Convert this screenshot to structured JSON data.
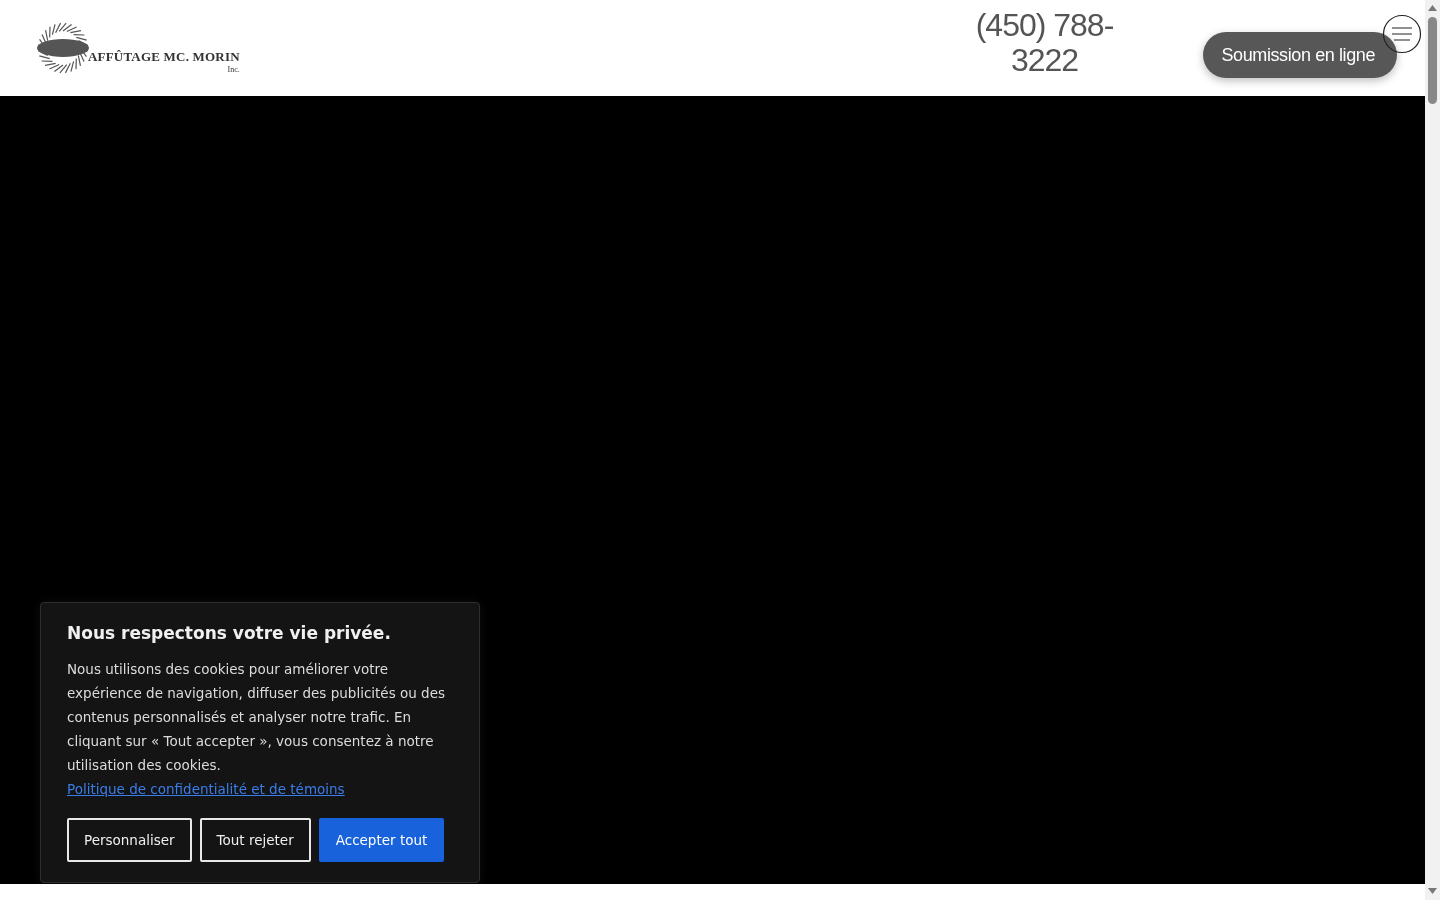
{
  "header": {
    "logo": {
      "name": "AFFÛTAGE MC. MORIN",
      "suffix": "Inc."
    },
    "phone_lines": [
      "(450) 788-",
      "3222"
    ],
    "cta_button": "Soumission en ligne"
  },
  "cookie_banner": {
    "title": "Nous respectons votre vie privée.",
    "text": "Nous utilisons des cookies pour améliorer votre expérience de navigation, diffuser des publicités ou des contenus personnalisés et analyser notre trafic. En cliquant sur « Tout accepter », vous consentez à notre utilisation des cookies.",
    "link": "Politique de confidentialité et de témoins",
    "buttons": [
      {
        "label": "Personnaliser",
        "kind": "outline"
      },
      {
        "label": "Tout rejeter",
        "kind": "outline"
      },
      {
        "label": "Accepter tout",
        "kind": "primary"
      }
    ]
  }
}
